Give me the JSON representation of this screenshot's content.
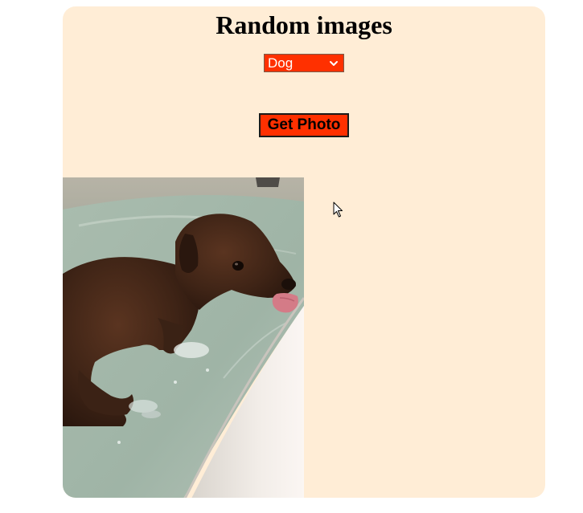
{
  "page": {
    "title": "Random images"
  },
  "controls": {
    "category_selected": "Dog",
    "get_photo_label": "Get Photo"
  },
  "colors": {
    "card_background": "#ffedd6",
    "accent": "#ff3000"
  },
  "icons": {
    "select_chevron": "chevron-down-icon",
    "cursor": "mouse-pointer-icon"
  }
}
